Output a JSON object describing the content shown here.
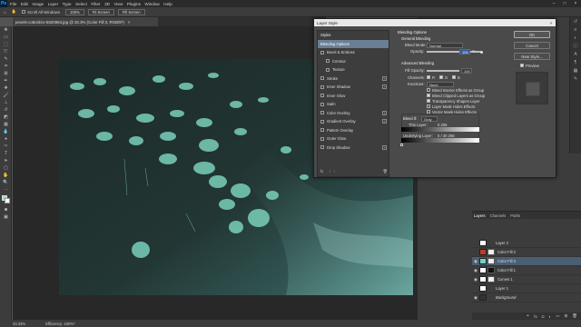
{
  "menubar": {
    "logo": "Ps",
    "items": [
      "File",
      "Edit",
      "Image",
      "Layer",
      "Type",
      "Select",
      "Filter",
      "3D",
      "View",
      "Plugins",
      "Window",
      "Help"
    ]
  },
  "options_bar": {
    "scroll_all": "Scroll All Windows",
    "zoom": "100%",
    "fit_screen": "Fit Screen",
    "fill_screen": "Fill Screen"
  },
  "document": {
    "tab_title": "pexels-cottonbro-5620963.jpg @ 33.3% (Color Fill 3, RGB/8*)",
    "tab_close": "×"
  },
  "status": {
    "zoom": "33.33%",
    "efficiency": "Efficiency: 100%*"
  },
  "window_controls": [
    "–",
    "□",
    "×"
  ],
  "dialog": {
    "title": "Layer Style",
    "close": "×",
    "styles_header": "Styles",
    "styles": [
      {
        "label": "Blending Options",
        "selected": true,
        "check": false,
        "plus": false
      },
      {
        "label": "Bevel & Emboss",
        "selected": false,
        "check": true,
        "plus": false
      },
      {
        "label": "Contour",
        "selected": false,
        "check": true,
        "plus": false,
        "indent": true
      },
      {
        "label": "Texture",
        "selected": false,
        "check": true,
        "plus": false,
        "indent": true
      },
      {
        "label": "Stroke",
        "selected": false,
        "check": true,
        "plus": true
      },
      {
        "label": "Inner Shadow",
        "selected": false,
        "check": true,
        "plus": true
      },
      {
        "label": "Inner Glow",
        "selected": false,
        "check": true,
        "plus": false
      },
      {
        "label": "Satin",
        "selected": false,
        "check": true,
        "plus": false
      },
      {
        "label": "Color Overlay",
        "selected": false,
        "check": true,
        "plus": true
      },
      {
        "label": "Gradient Overlay",
        "selected": false,
        "check": true,
        "plus": true
      },
      {
        "label": "Pattern Overlay",
        "selected": false,
        "check": true,
        "plus": false
      },
      {
        "label": "Outer Glow",
        "selected": false,
        "check": true,
        "plus": false
      },
      {
        "label": "Drop Shadow",
        "selected": false,
        "check": true,
        "plus": true
      }
    ],
    "footer_icons": [
      "fx",
      "↑",
      "↓",
      "trash"
    ],
    "blending": {
      "section": "Blending Options",
      "general": "General Blending",
      "blend_mode_label": "Blend Mode:",
      "blend_mode": "Normal",
      "opacity_label": "Opacity:",
      "opacity": "100",
      "opacity_pct": "%",
      "advanced": "Advanced Blending",
      "fill_opacity_label": "Fill Opacity:",
      "fill_opacity": "100",
      "channels_label": "Channels:",
      "channels": [
        "R",
        "G",
        "B"
      ],
      "knockout_label": "Knockout:",
      "knockout": "None",
      "options": [
        {
          "label": "Blend Interior Effects as Group",
          "checked": false
        },
        {
          "label": "Blend Clipped Layers as Group",
          "checked": true
        },
        {
          "label": "Transparency Shapes Layer",
          "checked": true
        },
        {
          "label": "Layer Mask Hides Effects",
          "checked": false
        },
        {
          "label": "Vector Mask Hides Effects",
          "checked": false
        }
      ],
      "blend_if_label": "Blend If:",
      "blend_if": "Gray",
      "this_layer_label": "This Layer:",
      "this_layer_values": "0       255",
      "underlying_label": "Underlying Layer:",
      "underlying_values": "0 / 20     255"
    },
    "buttons": {
      "ok": "OK",
      "cancel": "Cancel",
      "new_style": "New Style...",
      "preview": "Preview"
    }
  },
  "layers_panel": {
    "tabs": [
      "Layers",
      "Channels",
      "Paths"
    ],
    "layers": [
      {
        "name": "Layer 2",
        "thumb": "white",
        "mask": "",
        "selected": false,
        "visible": false
      },
      {
        "name": "Color Fill 2",
        "thumb": "red",
        "mask": "white",
        "selected": false,
        "visible": false
      },
      {
        "name": "Color Fill 3",
        "thumb": "teal",
        "mask": "white",
        "selected": true,
        "visible": true
      },
      {
        "name": "Color Fill 1",
        "thumb": "white",
        "mask": "dark",
        "selected": false,
        "visible": true
      },
      {
        "name": "Curves 1",
        "thumb": "white",
        "mask": "white",
        "selected": false,
        "visible": true
      },
      {
        "name": "Layer 1",
        "thumb": "white",
        "mask": "",
        "selected": false,
        "visible": false
      },
      {
        "name": "Background",
        "thumb": "dark",
        "mask": "",
        "selected": false,
        "visible": true
      }
    ],
    "bottom_icons": [
      "link",
      "fx",
      "mask",
      "adj",
      "folder",
      "new",
      "trash"
    ]
  },
  "colors": {
    "accent_selected": "#4a5f73",
    "style_selected": "#6a7e94",
    "photo_tint": "#7fd9c4"
  }
}
